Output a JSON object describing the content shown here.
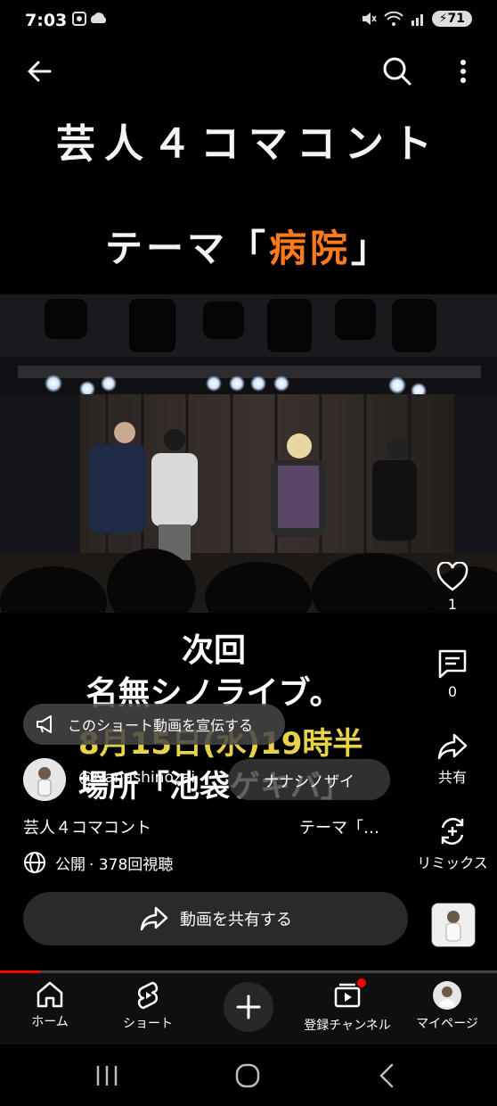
{
  "status_bar": {
    "time": "7:03",
    "battery": "71"
  },
  "overlay_text": {
    "title_line1": "芸人４コマコント",
    "title_line2_prefix": "テーマ「",
    "title_line2_accent": "病院",
    "title_line2_suffix": "」",
    "caption_line1": "次回",
    "caption_line2": "名無シノライブ。",
    "caption_line3": "8月15日(水)19時半",
    "caption_line4": "場所「池袋ゲキバ」"
  },
  "promo": {
    "label": "このショート動画を宣伝する"
  },
  "channel": {
    "name": "@Nanashinozai",
    "subscribe_label": "ナナシノザイ"
  },
  "actions": {
    "like_count": "1",
    "comment_count": "0",
    "share_label": "共有",
    "remix_label": "リミックス"
  },
  "video": {
    "title": "芸人４コマコント",
    "title_right": "テーマ「…",
    "visibility": "公開",
    "views": "· 378回視聴",
    "progress": 0.08
  },
  "share_button": {
    "label": "動画を共有する"
  },
  "bottom_nav": {
    "home": "ホーム",
    "shorts": "ショート",
    "subscriptions": "登録チャンネル",
    "mypage": "マイページ"
  },
  "colors": {
    "accent_orange": "#ff7a1a",
    "progress_red": "#ff0000",
    "notification_red": "#ff0000"
  }
}
